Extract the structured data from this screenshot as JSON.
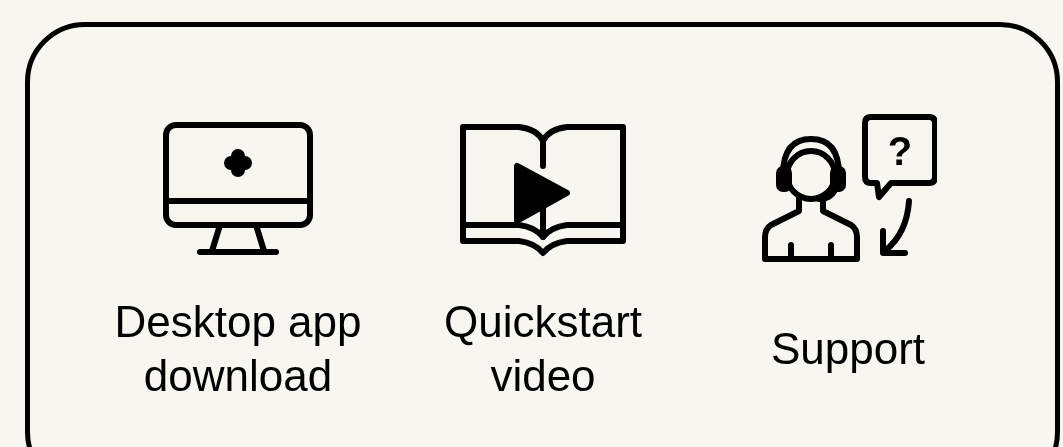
{
  "items": [
    {
      "kind": "monitor",
      "label": "Desktop app download"
    },
    {
      "kind": "book",
      "label": "Quickstart video"
    },
    {
      "kind": "support",
      "label": "Support",
      "icon_glyph": "?"
    }
  ]
}
